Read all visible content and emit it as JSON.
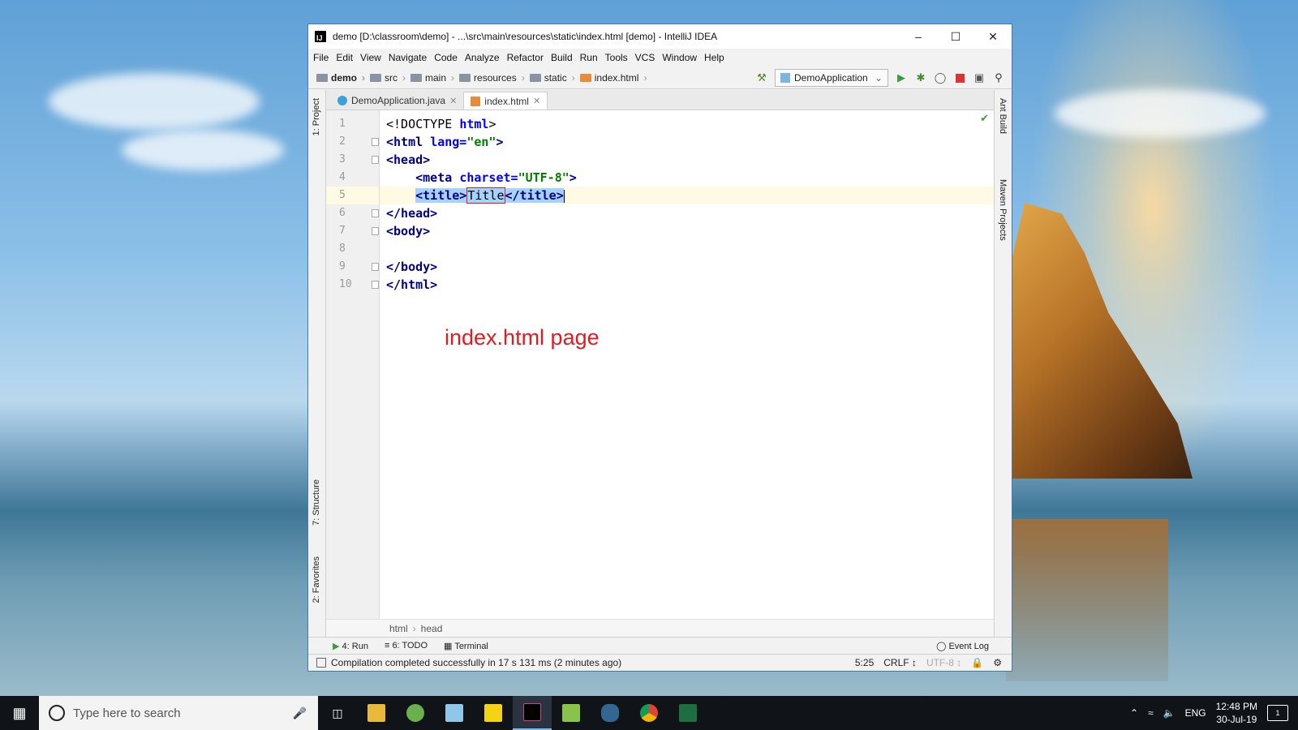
{
  "window": {
    "title": "demo [D:\\classroom\\demo] - ...\\src\\main\\resources\\static\\index.html [demo] - IntelliJ IDEA",
    "app_icon": "IJ"
  },
  "menu": [
    "File",
    "Edit",
    "View",
    "Navigate",
    "Code",
    "Analyze",
    "Refactor",
    "Build",
    "Run",
    "Tools",
    "VCS",
    "Window",
    "Help"
  ],
  "breadcrumb": [
    "demo",
    "src",
    "main",
    "resources",
    "static",
    "index.html"
  ],
  "run_config": "DemoApplication",
  "tabs": [
    {
      "label": "DemoApplication.java",
      "icon": "java-class-icon"
    },
    {
      "label": "index.html",
      "icon": "html-file-icon"
    }
  ],
  "side_tabs": {
    "left": [
      "1: Project",
      "7: Structure",
      "2: Favorites"
    ],
    "right": [
      "Ant Build",
      "Maven Projects"
    ]
  },
  "line_numbers": [
    "1",
    "2",
    "3",
    "4",
    "5",
    "6",
    "7",
    "8",
    "9",
    "10"
  ],
  "code": {
    "l1_open": "<!DOCTYPE ",
    "l1_kw": "html",
    "l1_close": ">",
    "l2_tag": "<html ",
    "l2_attr": "lang=",
    "l2_str": "\"en\"",
    "l2_close": ">",
    "l3": "<head>",
    "l4_tag": "<meta ",
    "l4_attr": "charset=",
    "l4_str": "\"UTF-8\"",
    "l4_close": ">",
    "l5_open": "<title>",
    "l5_text": "Title",
    "l5_close": "</title>",
    "l6": "</head>",
    "l7": "<body>",
    "l9": "</body>",
    "l10": "</html>"
  },
  "annotation": "index.html page",
  "editor_breadcrumb": [
    "html",
    "head"
  ],
  "bottom_tools": {
    "run": "4: Run",
    "todo": "6: TODO",
    "terminal": "Terminal",
    "event_log": "Event Log"
  },
  "status": {
    "message": "Compilation completed successfully in 17 s 131 ms (2 minutes ago)",
    "position": "5:25",
    "line_sep": "CRLF ↕",
    "encoding": "UTF-8 ↕"
  },
  "taskbar": {
    "search_placeholder": "Type here to search",
    "lang": "ENG",
    "time": "12:48 PM",
    "date": "30-Jul-19",
    "notif_count": "1"
  }
}
